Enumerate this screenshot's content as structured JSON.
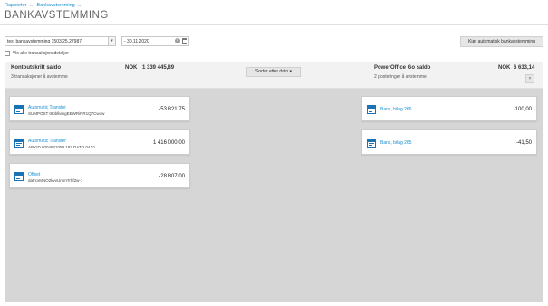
{
  "breadcrumb": [
    {
      "label": "Rapporter"
    },
    {
      "label": "Bankavstemming"
    }
  ],
  "breadcrumb_separator": "→",
  "page_title": "BANKAVSTEMMING",
  "toolbar": {
    "account_select_value": "test bankavstemming 1503.25.27987",
    "date_value": "- 30.11.2020",
    "show_details_label": "Vis alle transaksjonsdetaljer",
    "auto_reconcile_label": "Kjør automatisk bankavstemming"
  },
  "summary": {
    "left_title": "Kontoutskrift saldo",
    "left_subtitle": "3 transaksjoner å avstemme",
    "left_currency": "NOK",
    "left_amount": "1 339 445,89",
    "sort_label": "Sorter etter dato",
    "right_title": "PowerOffice Go saldo",
    "right_subtitle": "2 posteringer å avstemme",
    "right_currency": "NOK",
    "right_amount": "6 633,14",
    "close_label": "×"
  },
  "bank_transactions": [
    {
      "title": "Automatic Transfer",
      "description": "SUMPOST t8pbllvmgEEWRiRR1Q7Cwow",
      "amount": "-53 821,75"
    },
    {
      "title": "Automatic Transfer",
      "description": "ARKID 8004941059 182 DATO 04.11",
      "amount": "1 416 000,00"
    },
    {
      "title": "Offset",
      "description": "daFcvMNO2kvvUmmTrhf2w-1",
      "amount": "-28 807,00"
    }
  ],
  "ledger_postings": [
    {
      "title": "Bank, bilag 266",
      "amount": "-100,00"
    },
    {
      "title": "Bank, bilag 265",
      "amount": "-41,50"
    }
  ],
  "icons": {
    "bank_icon": "calendar-doc-icon",
    "calendar": "calendar-icon",
    "clear": "clear-icon",
    "dropdown": "chevron-down-icon"
  },
  "colors": {
    "link": "#1a8fd0",
    "panel_bg": "#d6d6d6",
    "icon": "#1a73b5"
  }
}
